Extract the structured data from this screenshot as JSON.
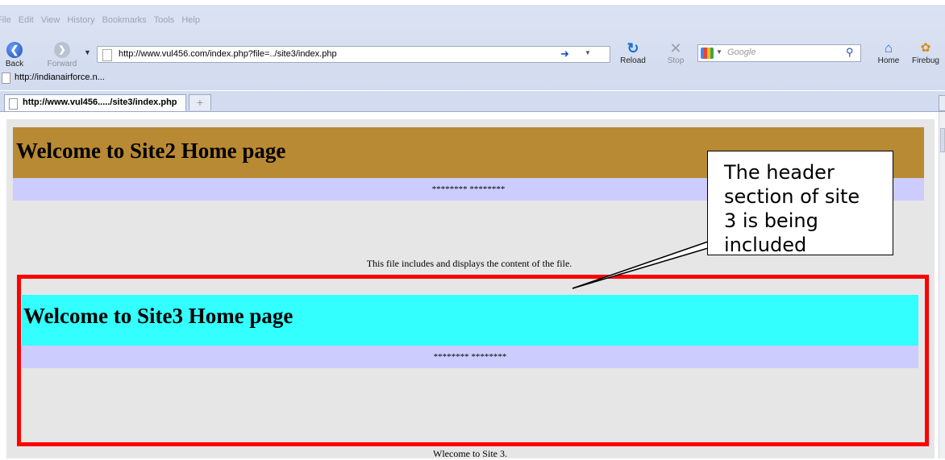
{
  "menu": [
    "File",
    "Edit",
    "View",
    "History",
    "Bookmarks",
    "Tools",
    "Help"
  ],
  "toolbar": {
    "back_label": "Back",
    "forward_label": "Forward",
    "reload_label": "Reload",
    "stop_label": "Stop",
    "home_label": "Home",
    "firebug_label": "Firebug"
  },
  "address": {
    "url": "http://www.vul456.com/index.php?file=../site3/index.php"
  },
  "search": {
    "placeholder": "Google"
  },
  "bookmarks": {
    "item": "http://indianairforce.n..."
  },
  "tab": {
    "title": "http://www.vul456...../site3/index.php"
  },
  "page": {
    "site2_title": "Welcome to Site2 Home page",
    "site2_sub": "******** ********",
    "intro": "This file includes and displays the content of the file.",
    "site3_title": "Welcome to Site3 Home page",
    "site3_sub": "******** ********",
    "site3_body": "Wlecome to Site 3."
  },
  "callout": {
    "line1": "The header",
    "line2": "section of site",
    "line3": "3 is being",
    "line4": "included"
  },
  "colors": {
    "site2_header": "#b88a33",
    "site3_header": "#33ffff",
    "sub_bar": "#ccccff",
    "highlight": "#ff0000"
  }
}
